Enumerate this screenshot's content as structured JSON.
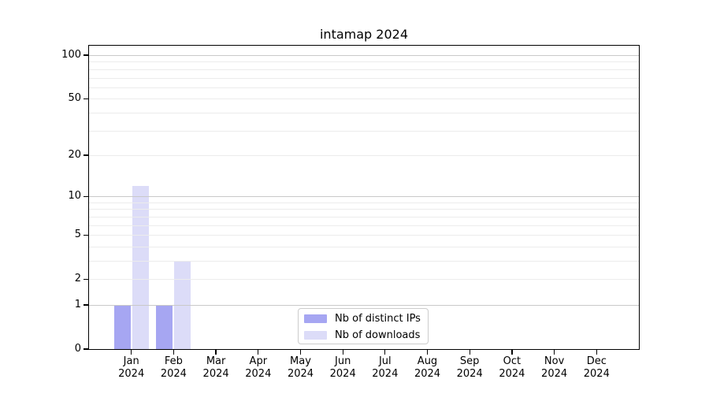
{
  "chart_data": {
    "type": "bar",
    "title": "intamap 2024",
    "categories": [
      "Jan",
      "Feb",
      "Mar",
      "Apr",
      "May",
      "Jun",
      "Jul",
      "Aug",
      "Sep",
      "Oct",
      "Nov",
      "Dec"
    ],
    "category_year": "2024",
    "series": [
      {
        "name": "Nb of distinct IPs",
        "color": "#a6a6f2",
        "values": [
          1,
          1,
          0,
          0,
          0,
          0,
          0,
          0,
          0,
          0,
          0,
          0
        ]
      },
      {
        "name": "Nb of downloads",
        "color": "#dcdcf8",
        "values": [
          12,
          3,
          0,
          0,
          0,
          0,
          0,
          0,
          0,
          0,
          0,
          0
        ]
      }
    ],
    "yscale": "log1p",
    "ylim": [
      0,
      117
    ],
    "yticks": [
      0,
      1,
      2,
      5,
      10,
      20,
      50,
      100
    ],
    "major_gridlines": [
      1,
      10,
      100
    ],
    "minor_gridlines": [
      2,
      3,
      4,
      5,
      6,
      7,
      8,
      9,
      20,
      30,
      40,
      50,
      60,
      70,
      80,
      90
    ],
    "grid": true,
    "legend_position": "lower center",
    "xlabel": "",
    "ylabel": ""
  },
  "colors": {
    "major_grid": "#c9c9c9",
    "minor_grid": "#ececec",
    "spine": "#000000",
    "background": "#ffffff",
    "legend_border": "#cccccc"
  }
}
